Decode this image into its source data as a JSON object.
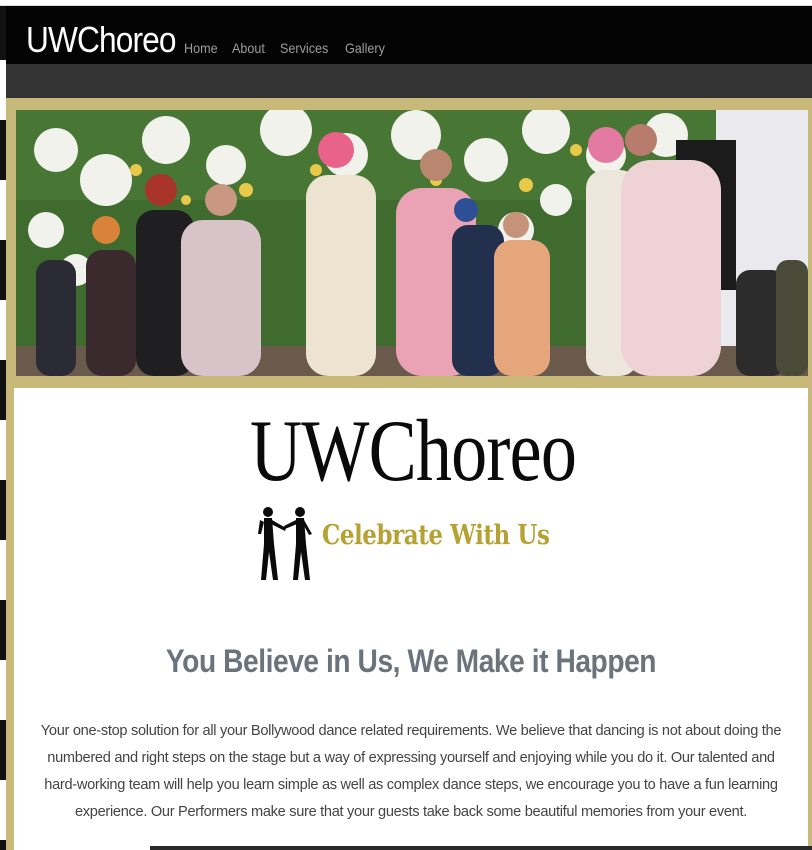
{
  "navbar": {
    "brand": "UWChoreo",
    "links": [
      "Home",
      "About",
      "Services",
      "Gallery"
    ]
  },
  "hero": {
    "image_alt": "Bollywood wedding dance photo"
  },
  "logo": {
    "title": "UWChoreo",
    "tagline": "Celebrate With Us",
    "tagline_color": "#b5a232"
  },
  "main": {
    "headline": "You Believe in Us, We Make it Happen",
    "body": "Your one-stop solution for all your Bollywood dance related requirements. We believe that dancing is not about doing the numbered and right steps on the stage but a way of expressing yourself and enjoying while you do it. Our talented and hard-working team will help you learn simple as well as complex dance steps, we encourage you to have a fun learning experience. Our Performers make sure that your guests take back some beautiful memories from your event."
  },
  "colors": {
    "navbar_bg": "#030303",
    "frame_gold": "#c8b87a",
    "headline": "#6b737d"
  }
}
